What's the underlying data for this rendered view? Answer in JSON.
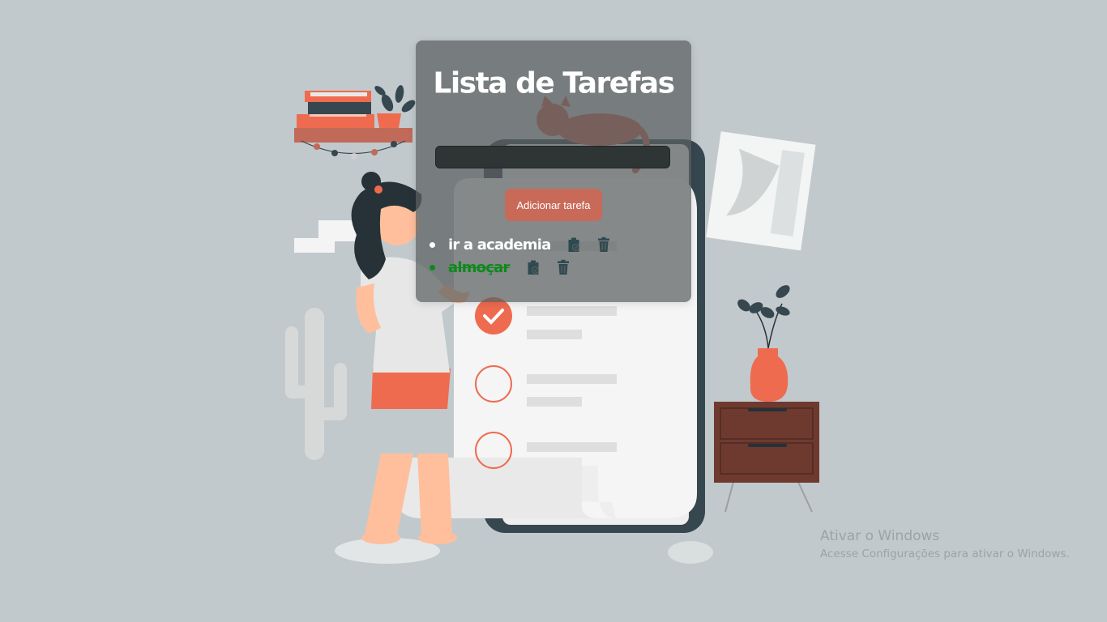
{
  "app": {
    "title": "Lista de Tarefas"
  },
  "form": {
    "input_value": "",
    "input_placeholder": "",
    "add_button_label": "Adicionar tarefa"
  },
  "tasks": [
    {
      "text": "ir a academia",
      "completed": false,
      "color": "#ffffff"
    },
    {
      "text": "almoçar",
      "completed": true,
      "color": "#0d8a1b"
    }
  ],
  "icons": {
    "complete": "clipboard-check-icon",
    "delete": "trash-icon"
  },
  "colors": {
    "background": "#c1c9cc",
    "accent": "#c96a59",
    "card": "#5a5f5f",
    "completed_task": "#0d8a1b",
    "icon": "#2e4a50"
  },
  "windows_watermark": {
    "title": "Ativar o Windows",
    "subtitle": "Acesse Configurações para ativar o Windows."
  }
}
